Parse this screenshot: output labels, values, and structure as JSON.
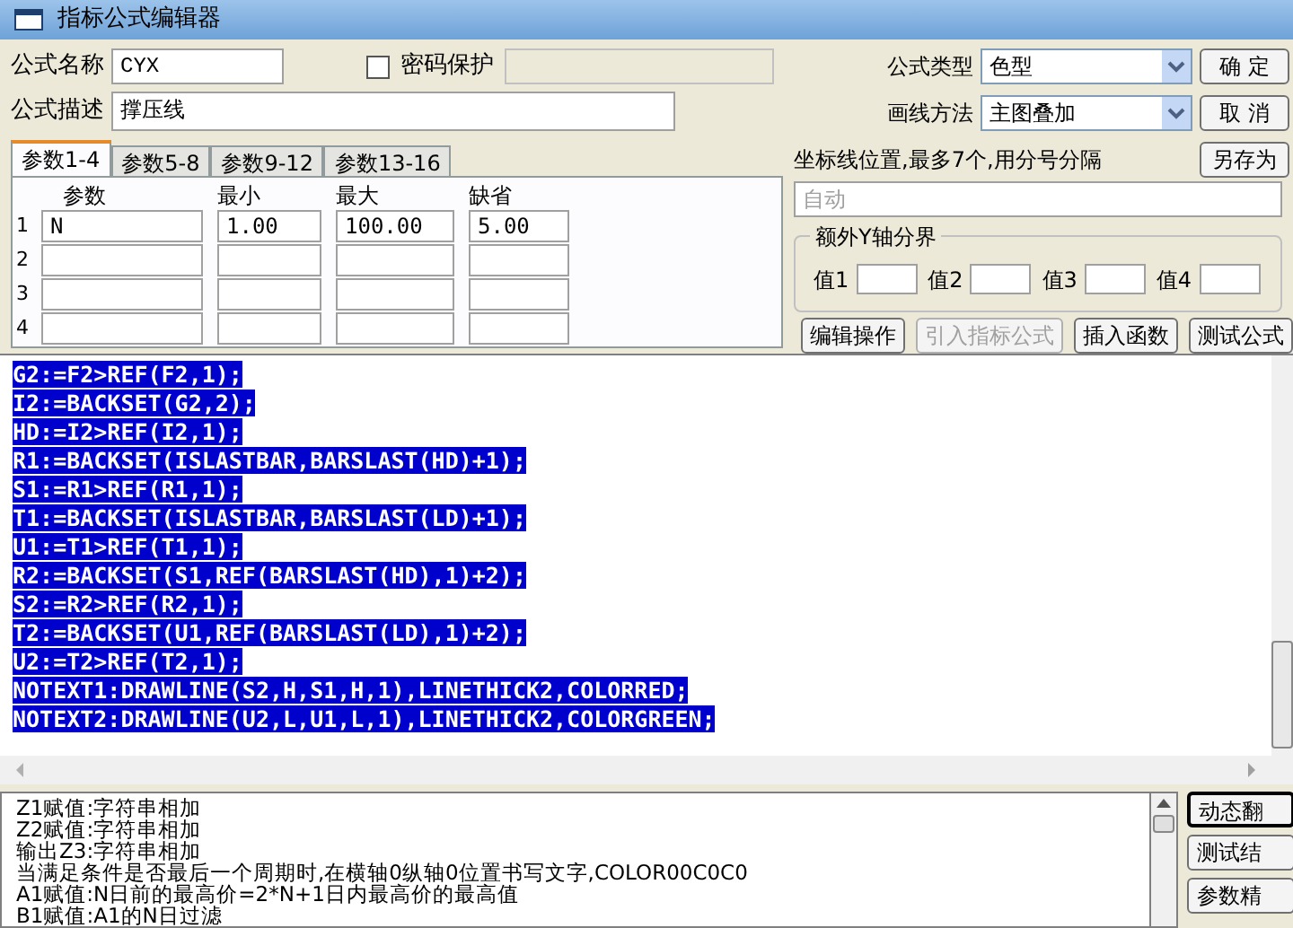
{
  "window": {
    "title": "指标公式编辑器"
  },
  "form": {
    "name_label": "公式名称",
    "name_value": "CYX",
    "password": {
      "label": "密码保护",
      "checked": false
    },
    "description_label": "公式描述",
    "description_value": "撑压线"
  },
  "formula_type": {
    "label": "公式类型",
    "value": "色型"
  },
  "draw_method": {
    "label": "画线方法",
    "value": "主图叠加"
  },
  "dialog_buttons": [
    "确 定",
    "取 消",
    "另存为"
  ],
  "tabs": [
    {
      "label": "参数1-4",
      "selected": true
    },
    {
      "label": "参数5-8",
      "selected": false
    },
    {
      "label": "参数9-12",
      "selected": false
    },
    {
      "label": "参数13-16",
      "selected": false
    }
  ],
  "param_table": {
    "columns": [
      "参数",
      "最小",
      "最大",
      "缺省"
    ],
    "rows": [
      {
        "index": "1",
        "name": "N",
        "min": "1.00",
        "max": "100.00",
        "default": "5.00"
      },
      {
        "index": "2"
      },
      {
        "index": "3"
      },
      {
        "index": "4"
      }
    ]
  },
  "axis_positions": {
    "label": "坐标线位置,最多7个,用分号分隔",
    "placeholder": "自动"
  },
  "y_axis_group": {
    "title": "额外Y轴分界",
    "fields": [
      "值1",
      "值2",
      "值3",
      "值4"
    ]
  },
  "action_buttons": [
    {
      "label": "编辑操作",
      "disabled": false
    },
    {
      "label": "引入指标公式",
      "disabled": true
    },
    {
      "label": "插入函数",
      "disabled": false
    },
    {
      "label": "测试公式",
      "disabled": false
    }
  ],
  "code": {
    "selected": true,
    "lines": [
      "G2:=F2>REF(F2,1);",
      "I2:=BACKSET(G2,2);",
      "HD:=I2>REF(I2,1);",
      "R1:=BACKSET(ISLASTBAR,BARSLAST(HD)+1);",
      "S1:=R1>REF(R1,1);",
      "T1:=BACKSET(ISLASTBAR,BARSLAST(LD)+1);",
      "U1:=T1>REF(T1,1);",
      "R2:=BACKSET(S1,REF(BARSLAST(HD),1)+2);",
      "S2:=R2>REF(R2,1);",
      "T2:=BACKSET(U1,REF(BARSLAST(LD),1)+2);",
      "U2:=T2>REF(T2,1);",
      "NOTEXT1:DRAWLINE(S2,H,S1,H,1),LINETHICK2,COLORRED;",
      "NOTEXT2:DRAWLINE(U2,L,U1,L,1),LINETHICK2,COLORGREEN;"
    ]
  },
  "messages": [
    "Z1赋值:字符串相加",
    "Z2赋值:字符串相加",
    "输出Z3:字符串相加",
    "当满足条件是否最后一个周期时,在横轴0纵轴0位置书写文字,COLOR00C0C0",
    "A1赋值:N日前的最高价=2*N+1日内最高价的最高值",
    "B1赋值:A1的N日过滤"
  ],
  "side_buttons": [
    "动态翻",
    "测试结",
    "参数精"
  ]
}
